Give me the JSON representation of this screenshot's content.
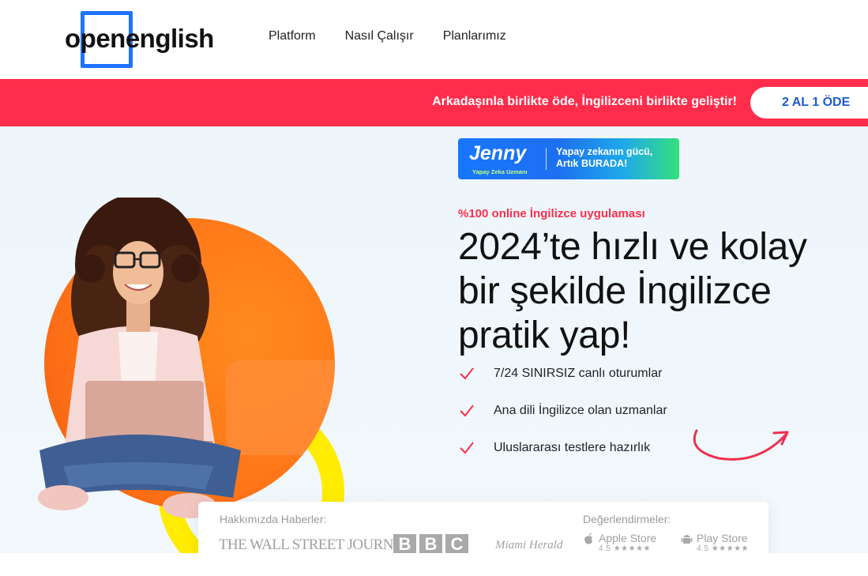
{
  "brand": {
    "logo_text": "openenglish"
  },
  "nav": {
    "items": [
      "Platform",
      "Nasıl Çalışır",
      "Planlarımız"
    ]
  },
  "promo": {
    "text": "Arkadaşınla birlikte öde, İngilizceni birlikte geliştir!",
    "button_label": "2 AL 1 ÖDE"
  },
  "jenny": {
    "name": "Jenny",
    "subtitle": "Yapay Zeka Uzmanı",
    "tagline_line1": "Yapay zekanın gücü,",
    "tagline_line2": "Artık BURADA!"
  },
  "hero": {
    "eyebrow": "%100 online İngilizce uygulaması",
    "headline": "2024’te hızlı ve kolay bir şekilde İngilizce pratik yap!",
    "features": [
      "7/24 SINIRSIZ canlı oturumlar",
      "Ana dili İngilizce olan uzmanlar",
      "Uluslararası testlere hazırlık"
    ]
  },
  "press": {
    "label": "Hakkımızda Haberler:",
    "outlets": [
      "THE WALL STREET JOURNAL.",
      "BBC",
      "Miami Herald"
    ]
  },
  "ratings": {
    "label": "Değerlendirmeler:",
    "stores": [
      {
        "name": "Apple Store",
        "score": "4.5",
        "stars": "★★★★★",
        "icon": "apple-icon"
      },
      {
        "name": "Play Store",
        "score": "4.5",
        "stars": "★★★★★",
        "icon": "android-icon"
      }
    ]
  },
  "colors": {
    "brand_blue": "#1e73ff",
    "promo_red": "#ff2d4b",
    "circle_orange": "#ff7418",
    "ring_yellow": "#ffec00"
  }
}
